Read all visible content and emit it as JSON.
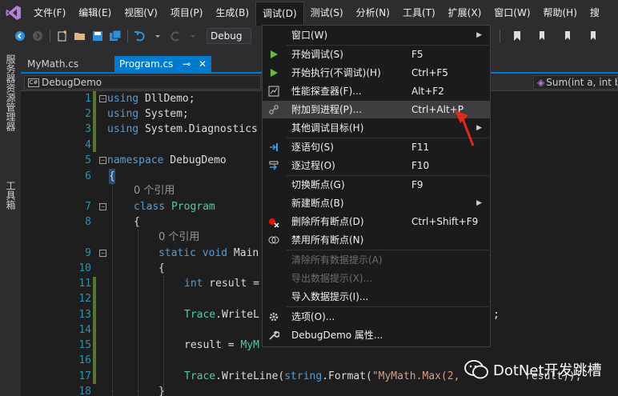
{
  "menubar": {
    "items": [
      "文件(F)",
      "编辑(E)",
      "视图(V)",
      "项目(P)",
      "生成(B)",
      "调试(D)",
      "测试(S)",
      "分析(N)",
      "工具(T)",
      "扩展(X)",
      "窗口(W)",
      "帮助(H)",
      "搜"
    ],
    "active_index": 5
  },
  "toolbar": {
    "config": "Debug"
  },
  "side_panel": {
    "labels": [
      "服务器资源管理器",
      "工具箱"
    ]
  },
  "tabs": [
    {
      "label": "MyMath.cs",
      "active": false
    },
    {
      "label": "Program.cs",
      "active": true,
      "pin": "⊸",
      "close": "✕"
    }
  ],
  "navbar": {
    "left": "DebugDemo",
    "right": "Sum(int a, int b)"
  },
  "editor": {
    "line_numbers": [
      "1",
      "2",
      "3",
      "4",
      "5",
      "6",
      "7",
      "8",
      "9",
      "10",
      "11",
      "12",
      "13",
      "14",
      "15",
      "16",
      "17",
      "18"
    ],
    "lines": {
      "l1_kw": "using",
      "l1_rest": " DllDemo;",
      "l2_kw": "using",
      "l2_rest": " System;",
      "l3_kw": "using",
      "l3_rest": " System.Diagnostics",
      "l5_kw": "namespace",
      "l5_rest": " DebugDemo",
      "l6": "{",
      "ref1": "0 个引用",
      "l7_kw": "class",
      "l7_ty": " Program",
      "l8": "{",
      "ref2": "0 个引用",
      "l9_kw": "static void",
      "l9_rest": " Main",
      "l10": "{",
      "l11_kw": "int",
      "l11_rest": " result =",
      "l13_ty": "Trace",
      "l13_rest": ".WriteL",
      "l13_tail": ";",
      "l15_rest": "result = ",
      "l15_ty": "MyM",
      "l17_ty": "Trace",
      "l17_rest": ".WriteLine(",
      "l17_kw": "string",
      "l17_rest2": ".Format(",
      "l17_str": "\"MyMath.Max(2,",
      "l17_rest3": "result));",
      "l18": "}"
    }
  },
  "debug_menu": {
    "items": [
      {
        "label": "窗口(W)",
        "shortcut": "",
        "submenu": true,
        "icon": "none",
        "disabled": false
      },
      {
        "label": "开始调试(S)",
        "shortcut": "F5",
        "submenu": false,
        "icon": "play-green-icon",
        "disabled": false
      },
      {
        "label": "开始执行(不调试)(H)",
        "shortcut": "Ctrl+F5",
        "submenu": false,
        "icon": "play-outline-icon",
        "disabled": false
      },
      {
        "label": "性能探查器(F)...",
        "shortcut": "Alt+F2",
        "submenu": false,
        "icon": "profiler-icon",
        "disabled": false
      },
      {
        "label": "附加到进程(P)...",
        "shortcut": "Ctrl+Alt+P",
        "submenu": false,
        "icon": "attach-process-icon",
        "disabled": false
      },
      {
        "label": "其他调试目标(H)",
        "shortcut": "",
        "submenu": true,
        "icon": "none",
        "disabled": false
      },
      {
        "label": "逐语句(S)",
        "shortcut": "F11",
        "submenu": false,
        "icon": "step-into-icon",
        "disabled": false
      },
      {
        "label": "逐过程(O)",
        "shortcut": "F10",
        "submenu": false,
        "icon": "step-over-icon",
        "disabled": false
      },
      {
        "label": "切换断点(G)",
        "shortcut": "F9",
        "submenu": false,
        "icon": "none",
        "disabled": false
      },
      {
        "label": "新建断点(B)",
        "shortcut": "",
        "submenu": true,
        "icon": "none",
        "disabled": false
      },
      {
        "label": "删除所有断点(D)",
        "shortcut": "Ctrl+Shift+F9",
        "submenu": false,
        "icon": "delete-breakpoints-icon",
        "disabled": false
      },
      {
        "label": "禁用所有断点(N)",
        "shortcut": "",
        "submenu": false,
        "icon": "disable-breakpoints-icon",
        "disabled": false
      },
      {
        "label": "清除所有数据提示(A)",
        "shortcut": "",
        "submenu": false,
        "icon": "none",
        "disabled": true
      },
      {
        "label": "导出数据提示(X)...",
        "shortcut": "",
        "submenu": false,
        "icon": "none",
        "disabled": true
      },
      {
        "label": "导入数据提示(I)...",
        "shortcut": "",
        "submenu": false,
        "icon": "none",
        "disabled": false
      },
      {
        "label": "选项(O)...",
        "shortcut": "",
        "submenu": false,
        "icon": "gear-icon",
        "disabled": false
      },
      {
        "label": "DebugDemo 属性...",
        "shortcut": "",
        "submenu": false,
        "icon": "wrench-icon",
        "disabled": false
      }
    ],
    "highlighted_index": 4
  },
  "watermark": {
    "text": "DotNet开发跳槽"
  },
  "colors": {
    "accent": "#007acc",
    "annotation_arrow": "#e0291b",
    "play_green": "#6ab843"
  }
}
